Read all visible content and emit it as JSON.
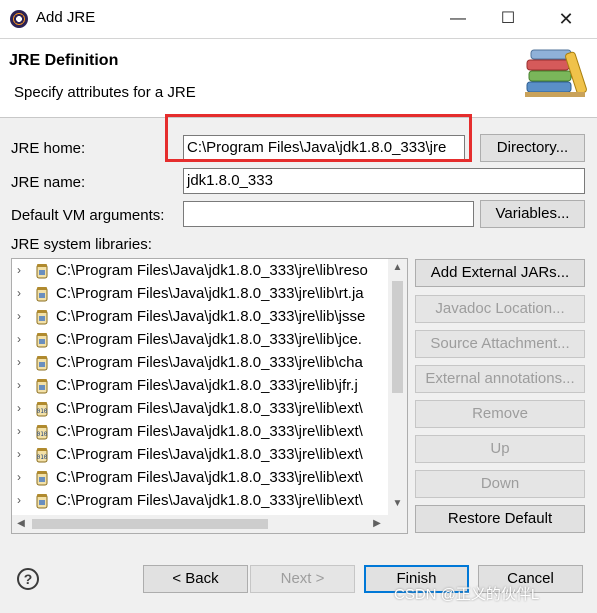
{
  "window": {
    "title": "Add JRE",
    "minimize": "—",
    "maximize": "☐",
    "close": "✕"
  },
  "banner": {
    "title": "JRE Definition",
    "subtitle": "Specify attributes for a JRE"
  },
  "form": {
    "jre_home_label": "JRE home:",
    "jre_home_value": "C:\\Program Files\\Java\\jdk1.8.0_333\\jre",
    "directory_button": "Directory...",
    "jre_name_label": "JRE name:",
    "jre_name_value": "jdk1.8.0_333",
    "vm_args_label": "Default VM arguments:",
    "vm_args_value": "",
    "variables_button": "Variables...",
    "libraries_label": "JRE system libraries:"
  },
  "libraries": [
    {
      "path": "C:\\Program Files\\Java\\jdk1.8.0_333\\jre\\lib\\reso",
      "icon": "jar-icon"
    },
    {
      "path": "C:\\Program Files\\Java\\jdk1.8.0_333\\jre\\lib\\rt.ja",
      "icon": "jar-icon"
    },
    {
      "path": "C:\\Program Files\\Java\\jdk1.8.0_333\\jre\\lib\\jsse",
      "icon": "jar-icon"
    },
    {
      "path": "C:\\Program Files\\Java\\jdk1.8.0_333\\jre\\lib\\jce.",
      "icon": "jar-icon"
    },
    {
      "path": "C:\\Program Files\\Java\\jdk1.8.0_333\\jre\\lib\\cha",
      "icon": "jar-icon"
    },
    {
      "path": "C:\\Program Files\\Java\\jdk1.8.0_333\\jre\\lib\\jfr.j",
      "icon": "jar-icon"
    },
    {
      "path": "C:\\Program Files\\Java\\jdk1.8.0_333\\jre\\lib\\ext\\",
      "icon": "binary-jar-icon"
    },
    {
      "path": "C:\\Program Files\\Java\\jdk1.8.0_333\\jre\\lib\\ext\\",
      "icon": "binary-jar-icon"
    },
    {
      "path": "C:\\Program Files\\Java\\jdk1.8.0_333\\jre\\lib\\ext\\",
      "icon": "binary-jar-icon"
    },
    {
      "path": "C:\\Program Files\\Java\\jdk1.8.0_333\\jre\\lib\\ext\\",
      "icon": "jar-icon"
    },
    {
      "path": "C:\\Program Files\\Java\\jdk1.8.0_333\\jre\\lib\\ext\\",
      "icon": "jar-icon"
    }
  ],
  "side_buttons": {
    "add_external_jars": "Add External JARs...",
    "javadoc_location": "Javadoc Location...",
    "source_attachment": "Source Attachment...",
    "external_annotations": "External annotations...",
    "remove": "Remove",
    "up": "Up",
    "down": "Down",
    "restore_default": "Restore Default"
  },
  "footer": {
    "help": "?",
    "back": "< Back",
    "next": "Next >",
    "finish": "Finish",
    "cancel": "Cancel"
  },
  "watermark": "CSDN @正义的伙伴L",
  "colors": {
    "highlight_box": "#e52d2d",
    "default_button_border": "#0078d7"
  }
}
